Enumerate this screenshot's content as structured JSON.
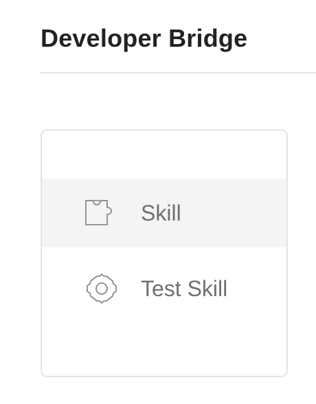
{
  "header": {
    "title": "Developer Bridge"
  },
  "menu": {
    "items": [
      {
        "label": "Skill",
        "icon": "puzzle-icon",
        "selected": true
      },
      {
        "label": "Test Skill",
        "icon": "gear-icon",
        "selected": false
      }
    ]
  },
  "colors": {
    "title": "#222222",
    "label": "#707070",
    "icon": "#8a8a8a",
    "divider": "#e4e4e4",
    "selected_background": "#f4f4f4",
    "card_border": "#e4e4e4"
  }
}
